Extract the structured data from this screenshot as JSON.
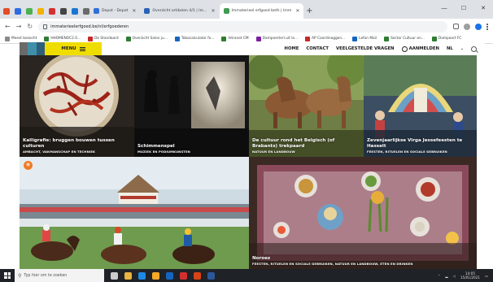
{
  "browser": {
    "tabs": [
      {
        "label": "Depot - Depot",
        "color": "#2f6fd8"
      },
      {
        "label": "Overzicht artikelen 4/1 | Im...",
        "color": "#2962b8"
      },
      {
        "label": "Immaterieel erfgoed beth | Imm",
        "color": "#3f9b53",
        "active": true
      }
    ],
    "mini_tab_colors": [
      "#e34c26",
      "#2d6cdf",
      "#4caf50",
      "#f2b200",
      "#d32f2f",
      "#444444",
      "#1976d2",
      "#6b6b6b"
    ],
    "url": "immaterieelerfgoed.be/nl/erfgoederen",
    "bookmarks": [
      {
        "label": "Meest bezocht",
        "color": "#8a8a8a"
      },
      {
        "label": "HHOMENOC2.0...",
        "color": "#2e7d32"
      },
      {
        "label": "De Standaard",
        "color": "#c62828"
      },
      {
        "label": "Overzicht Salon ju...",
        "color": "#2e7d32"
      },
      {
        "label": "Tobacalculator fo...",
        "color": "#1565c0"
      },
      {
        "label": "Intranet CM",
        "color": "#2e7d32"
      },
      {
        "label": "Dampoerterl.uit le...",
        "color": "#7b1fa2"
      },
      {
        "label": "AP Coordinaggen...",
        "color": "#c62828"
      },
      {
        "label": "Lefon Mail",
        "color": "#1565c0"
      },
      {
        "label": "Sector Cultuur en...",
        "color": "#2e7d32"
      },
      {
        "label": "Dampoort FC",
        "color": "#2e7d32"
      }
    ]
  },
  "site": {
    "logo_colors": [
      "#6a6a6a",
      "#3f8fa8",
      "#2d5f7a"
    ],
    "menu_label": "MENU",
    "nav": [
      "HOME",
      "CONTACT",
      "VEELGESTELDE VRAGEN"
    ],
    "login_label": "AANMELDEN",
    "language": "NL"
  },
  "cards": [
    {
      "title": "Kalligrafie: bruggen bouwen tussen culturen",
      "category": "AMBACHT, VAKMANSCHAP EN TECHNIEK"
    },
    {
      "title": "Schimmenspel",
      "category": "MUZIEK EN PODIUMKUNSTEN"
    },
    {
      "title": "De cultuur rond het Belgisch (of Brabants) trekpaard",
      "category": "NATUUR EN LANDBOUW"
    },
    {
      "title": "Zevenjaarlijkse Virga Jessefeesten te Hasselt",
      "category": "FEESTEN, RITUELEN EN SOCIALE GEBRUIKEN"
    },
    {
      "title": "",
      "category": "",
      "badge": "✵"
    },
    {
      "title": "Noroez",
      "category": "FEESTEN, RITUELEN EN SOCIALE GEBRUIKEN, NATUUR EN LANDBOUW, ETEN EN DRINKEN"
    }
  ],
  "taskbar": {
    "search_placeholder": "Typ hier om te zoeken",
    "time": "14:05",
    "date": "15/01/2021",
    "icon_colors": [
      "#cccccc",
      "#e8b341",
      "#1e88e5",
      "#f9a825",
      "#1565c0",
      "#d32f2f",
      "#d84315",
      "#2b579a"
    ]
  }
}
